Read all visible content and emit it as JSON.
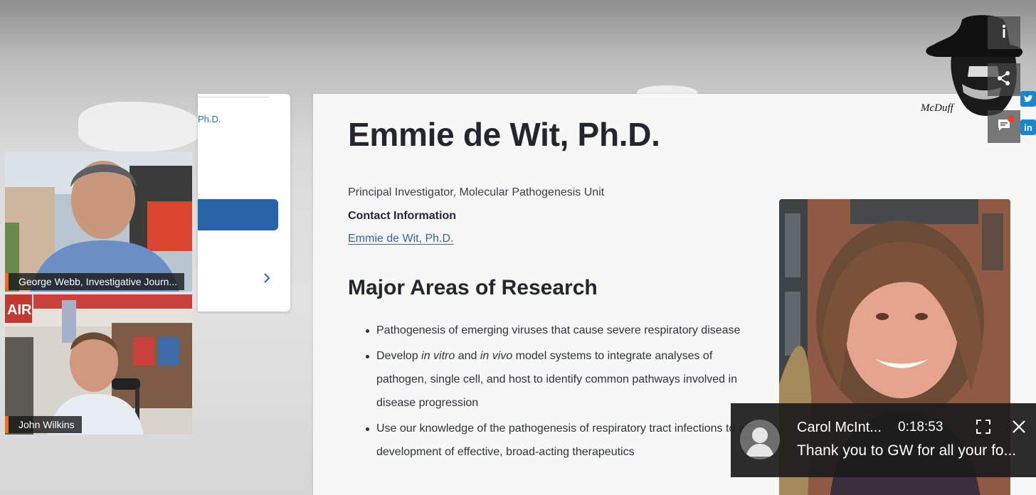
{
  "side_card": {
    "link_text": "Ph.D."
  },
  "page": {
    "title": "Emmie de Wit, Ph.D.",
    "role": "Principal Investigator, Molecular Pathogenesis Unit",
    "contact_heading": "Contact Information",
    "contact_link": "Emmie de Wit, Ph.D.",
    "section_heading": "Major Areas of Research",
    "research_items": [
      "Pathogenesis of emerging viruses that cause severe respiratory disease",
      "Develop in vitro and in vivo model systems to integrate analyses of pathogen, single cell, and host to identify common pathways involved in disease progression",
      "Use our knowledge of the pathogenesis of respiratory tract infections to aid development of effective, broad-acting therapeutics"
    ]
  },
  "participants": [
    {
      "name": "George Webb, Investigative Journ..."
    },
    {
      "name": "John Wilkins"
    }
  ],
  "controls": {
    "info_icon": "info-icon",
    "share_icon": "share-icon",
    "chat_icon": "chat-icon",
    "logo_text": "McDuff"
  },
  "social": {
    "linkedin": "in"
  },
  "chat": {
    "author": "Carol McInt...",
    "timestamp": "0:18:53",
    "message": "Thank you to GW for all your fo..."
  },
  "colors": {
    "accent_orange": "#f06a1e",
    "link_blue": "#2b65aa",
    "button_blue": "#2a64a8",
    "notification_red": "#e8432f"
  }
}
